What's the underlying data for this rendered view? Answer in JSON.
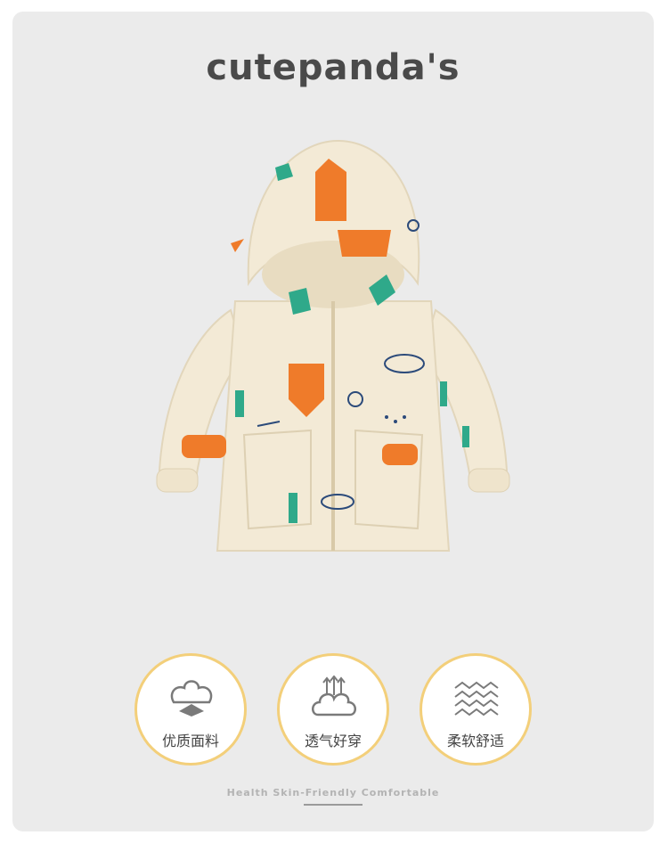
{
  "brand": {
    "logo_text": "cutepanda's"
  },
  "product": {
    "icon": "kids-hooded-jacket-image"
  },
  "features": [
    {
      "label": "优质面料",
      "icon": "cotton-flower-icon"
    },
    {
      "label": "透气好穿",
      "icon": "breathable-cloud-icon"
    },
    {
      "label": "柔软舒适",
      "icon": "soft-fabric-texture-icon"
    }
  ],
  "tagline": "Health  Skin-Friendly Comfortable",
  "colors": {
    "background": "#ebebeb",
    "accent_ring": "#f3cf7a",
    "text": "#444444"
  }
}
